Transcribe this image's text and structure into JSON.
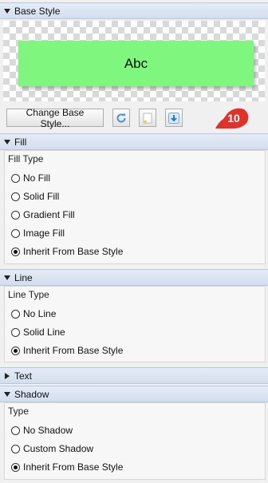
{
  "base_style": {
    "header": "Base Style",
    "preview_text": "Abc",
    "preview_fill": "#7ff77f",
    "change_button": "Change Base Style...",
    "icons": [
      "refresh-icon",
      "document-icon",
      "download-icon"
    ],
    "badge_number": "10",
    "badge_color": "#e0312b"
  },
  "fill": {
    "header": "Fill",
    "group_label": "Fill Type",
    "options": [
      "No Fill",
      "Solid Fill",
      "Gradient Fill",
      "Image Fill",
      "Inherit From Base Style"
    ],
    "selected": "Inherit From Base Style"
  },
  "line": {
    "header": "Line",
    "group_label": "Line Type",
    "options": [
      "No Line",
      "Solid Line",
      "Inherit From Base Style"
    ],
    "selected": "Inherit From Base Style"
  },
  "text": {
    "header": "Text"
  },
  "shadow": {
    "header": "Shadow",
    "group_label": "Type",
    "options": [
      "No Shadow",
      "Custom Shadow",
      "Inherit From Base Style"
    ],
    "selected": "Inherit From Base Style"
  }
}
